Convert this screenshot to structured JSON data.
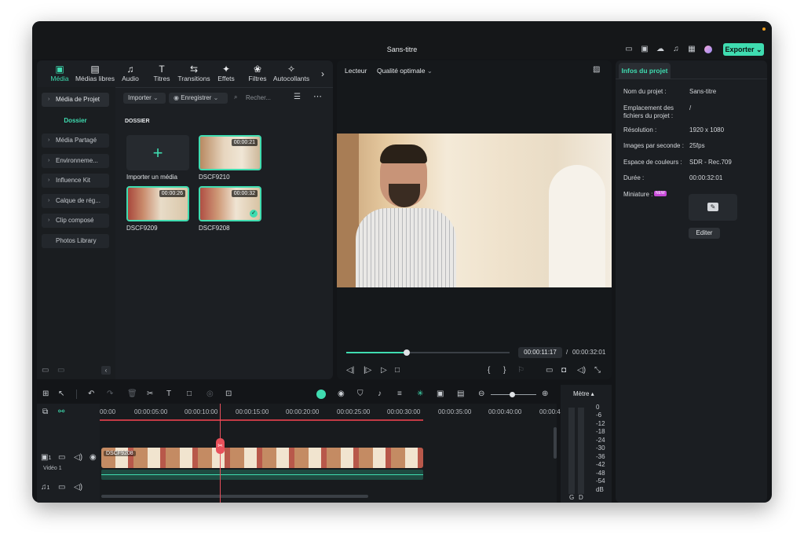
{
  "app": {
    "title": "Sans-titre",
    "export_label": "Exporter",
    "export_chevron": "⌄"
  },
  "media_tabs": [
    {
      "label": "Média",
      "icon": "media-icon"
    },
    {
      "label": "Médias libres",
      "icon": "stock-media-icon"
    },
    {
      "label": "Audio",
      "icon": "music-note-icon"
    },
    {
      "label": "Titres",
      "icon": "text-icon"
    },
    {
      "label": "Transitions",
      "icon": "transition-icon"
    },
    {
      "label": "Effets",
      "icon": "effects-icon"
    },
    {
      "label": "Filtres",
      "icon": "filters-icon"
    },
    {
      "label": "Autocollants",
      "icon": "sticker-icon"
    }
  ],
  "sidebar": {
    "project_media": "Média de Projet",
    "folder": "Dossier",
    "items": [
      "Média Partagé",
      "Environneme...",
      "Influence Kit",
      "Calque de rég...",
      "Clip composé"
    ],
    "photos": "Photos Library"
  },
  "library": {
    "import_label": "Importer",
    "record_label": "Enregistrer",
    "search_placeholder": "Recher...",
    "section": "DOSSIER",
    "import_media": "Importer un média",
    "clips": [
      {
        "name": "DSCF9210",
        "duration": "00:00:21"
      },
      {
        "name": "DSCF9209",
        "duration": "00:00:26"
      },
      {
        "name": "DSCF9208",
        "duration": "00:00:32"
      }
    ]
  },
  "player": {
    "label": "Lecteur",
    "quality": "Qualité optimale",
    "current_time": "00:00:11:17",
    "separator": "/",
    "total_time": "00:00:32:01",
    "progress": 0.37
  },
  "project_info": {
    "tab": "Infos du projet",
    "rows": [
      {
        "key": "Nom du projet :",
        "value": "Sans-titre"
      },
      {
        "key": "Emplacement des fichiers du projet :",
        "value": "/"
      },
      {
        "key": "Résolution :",
        "value": "1920 x 1080"
      },
      {
        "key": "Images par seconde :",
        "value": "25fps"
      },
      {
        "key": "Espace de couleurs :",
        "value": "SDR - Rec.709"
      },
      {
        "key": "Durée :",
        "value": "00:00:32:01"
      }
    ],
    "thumbnail_label": "Miniature :",
    "new_badge": "NEW",
    "edit_label": "Editer"
  },
  "timeline": {
    "ticks": [
      "00:00",
      "00:00:05:00",
      "00:00:10:00",
      "00:00:15:00",
      "00:00:20:00",
      "00:00:25:00",
      "00:00:30:00",
      "00:00:35:00",
      "00:00:40:00",
      "00:00:4"
    ],
    "clip_name": "DSCF9208",
    "video_track": "Vidéo 1",
    "video_track_num": "1",
    "audio_track_num": "1",
    "playhead_seconds": 11.7
  },
  "meter": {
    "title": "Mètre",
    "levels": [
      "0",
      "-6",
      "-12",
      "-18",
      "-24",
      "-30",
      "-36",
      "-42",
      "-48",
      "-54",
      "dB"
    ],
    "left": "G",
    "right": "D"
  },
  "colors": {
    "accent": "#3fdcb0",
    "playhead": "#e8505b",
    "bg": "#131518"
  }
}
